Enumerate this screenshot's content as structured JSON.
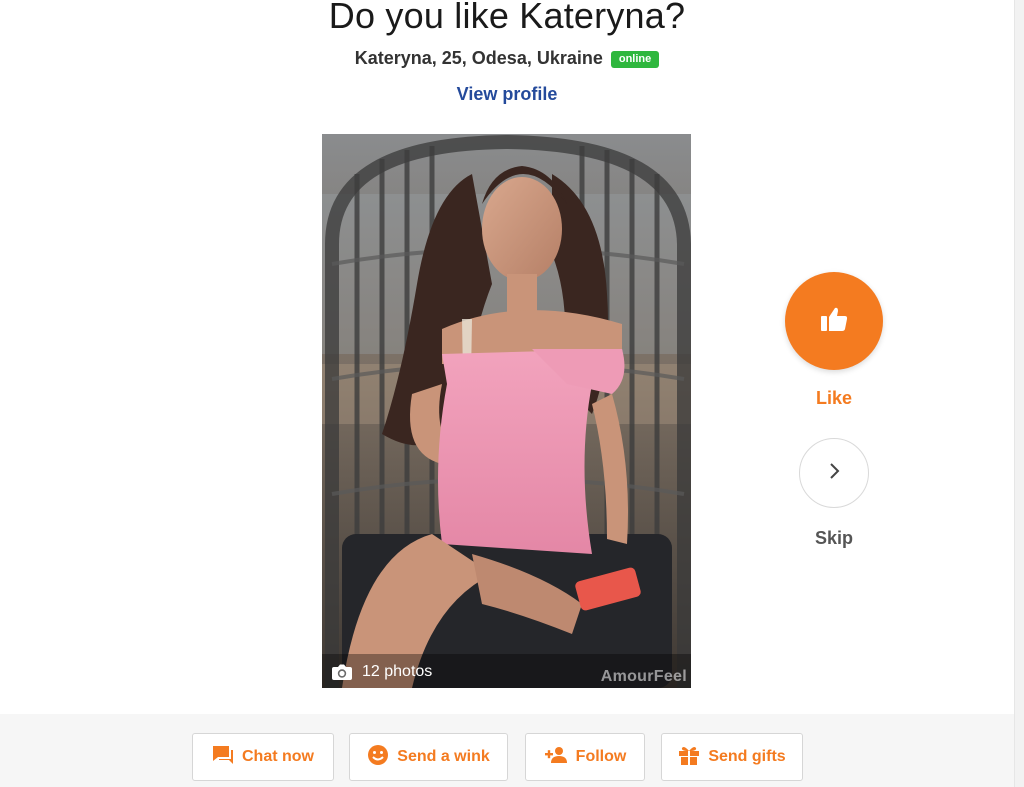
{
  "header": {
    "title": "Do you like Kateryna?",
    "subtitle": "Kateryna, 25, Odesa, Ukraine",
    "status_badge": "online",
    "view_profile": "View profile"
  },
  "photo": {
    "count_label": "12 photos",
    "watermark": "AmourFeel"
  },
  "vote": {
    "like_label": "Like",
    "skip_label": "Skip"
  },
  "actions": [
    {
      "label": "Chat now",
      "icon": "chat-icon"
    },
    {
      "label": "Send a wink",
      "icon": "smile-icon"
    },
    {
      "label": "Follow",
      "icon": "add-person-icon"
    },
    {
      "label": "Send gifts",
      "icon": "gift-icon"
    }
  ],
  "colors": {
    "accent": "#f47b20",
    "link": "#244a9b",
    "online": "#2fb73e"
  }
}
